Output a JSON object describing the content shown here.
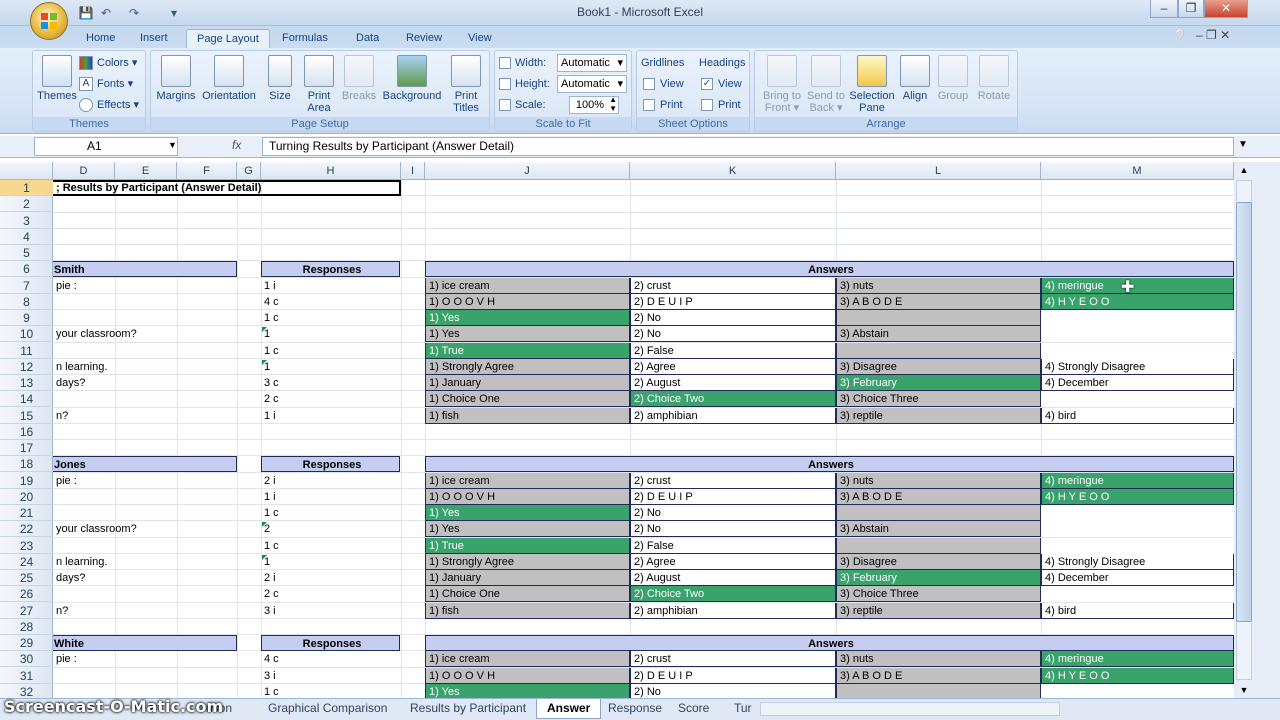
{
  "window": {
    "title": "Book1 - Microsoft Excel"
  },
  "colors": {
    "header_fill": "#c5cdf0",
    "gray_fill": "#c0c0c0",
    "green_fill": "#3aa36b"
  },
  "tabs": [
    "Home",
    "Insert",
    "Page Layout",
    "Formulas",
    "Data",
    "Review",
    "View"
  ],
  "active_tab": "Page Layout",
  "ribbon": {
    "themes": {
      "themes": "Themes",
      "colors": "Colors",
      "fonts": "Fonts",
      "effects": "Effects",
      "label": "Themes"
    },
    "page_setup": {
      "margins": "Margins",
      "orientation": "Orientation",
      "size": "Size",
      "print_area_1": "Print",
      "print_area_2": "Area",
      "breaks": "Breaks",
      "background": "Background",
      "print_titles_1": "Print",
      "print_titles_2": "Titles",
      "label": "Page Setup"
    },
    "scale": {
      "width_label": "Width:",
      "width_value": "Automatic",
      "height_label": "Height:",
      "height_value": "Automatic",
      "scale_label": "Scale:",
      "scale_value": "100%",
      "label": "Scale to Fit"
    },
    "sheet_options": {
      "gridlines": "Gridlines",
      "headings": "Headings",
      "view": "View",
      "print": "Print",
      "label": "Sheet Options"
    },
    "arrange": {
      "bring_1": "Bring to",
      "bring_2": "Front",
      "send_1": "Send to",
      "send_2": "Back",
      "selection_1": "Selection",
      "selection_2": "Pane",
      "align": "Align",
      "group": "Group",
      "rotate": "Rotate",
      "label": "Arrange"
    }
  },
  "formula_bar": {
    "name_box": "A1",
    "fx": "fx",
    "content": "Turning Results by Participant (Answer Detail)"
  },
  "columns": [
    "D",
    "E",
    "F",
    "G",
    "H",
    "I",
    "J",
    "K",
    "L",
    "M"
  ],
  "rows": [
    "1",
    "2",
    "3",
    "4",
    "5",
    "6",
    "7",
    "8",
    "9",
    "10",
    "11",
    "12",
    "13",
    "14",
    "15",
    "16",
    "17",
    "18",
    "19",
    "20",
    "21",
    "22",
    "23",
    "24",
    "25",
    "26",
    "27",
    "28",
    "29",
    "30",
    "31",
    "32"
  ],
  "sheet": {
    "title_cell": "; Results by Participant (Answer Detail)",
    "responses_header": "Responses",
    "answers_header": "Answers",
    "blocks": [
      {
        "name": "Smith",
        "questions": [
          "pie :",
          "",
          "",
          "your classroom?",
          "",
          "n learning.",
          "days?",
          "",
          "n?"
        ],
        "responses": [
          "1 i",
          "4 c",
          "1 c",
          "1",
          "1 c",
          "1",
          "3 c",
          "2 c",
          "1 i"
        ],
        "answers": [
          [
            "1)  ice cream",
            "2)  crust",
            "3)  nuts",
            "4)  meringue"
          ],
          [
            "1)  O O O V H",
            "2)  D E U I P",
            "3)  A B O D E",
            "4)  H Y E O O"
          ],
          [
            "1)  Yes",
            "2)  No",
            "",
            ""
          ],
          [
            "1)  Yes",
            "2)  No",
            "3)  Abstain",
            ""
          ],
          [
            "1)  True",
            "2)  False",
            "",
            ""
          ],
          [
            "1)  Strongly Agree",
            "2)  Agree",
            "3)  Disagree",
            "4)  Strongly Disagree"
          ],
          [
            "1)  January",
            "2)  August",
            "3)  February",
            "4)  December"
          ],
          [
            "1)  Choice One",
            "2)  Choice Two",
            "3)  Choice Three",
            ""
          ],
          [
            "1)  fish",
            "2)  amphibian",
            "3)  reptile",
            "4)  bird"
          ]
        ]
      },
      {
        "name": "Jones",
        "questions": [
          "pie :",
          "",
          "",
          "your classroom?",
          "",
          "n learning.",
          "days?",
          "",
          "n?"
        ],
        "responses": [
          "2 i",
          "1 i",
          "1 c",
          "2",
          "1 c",
          "1",
          "2 i",
          "2 c",
          "3 i"
        ],
        "answers": [
          [
            "1)  ice cream",
            "2)  crust",
            "3)  nuts",
            "4)  meringue"
          ],
          [
            "1)  O O O V H",
            "2)  D E U I P",
            "3)  A B O D E",
            "4)  H Y E O O"
          ],
          [
            "1)  Yes",
            "2)  No",
            "",
            ""
          ],
          [
            "1)  Yes",
            "2)  No",
            "3)  Abstain",
            ""
          ],
          [
            "1)  True",
            "2)  False",
            "",
            ""
          ],
          [
            "1)  Strongly Agree",
            "2)  Agree",
            "3)  Disagree",
            "4)  Strongly Disagree"
          ],
          [
            "1)  January",
            "2)  August",
            "3)  February",
            "4)  December"
          ],
          [
            "1)  Choice One",
            "2)  Choice Two",
            "3)  Choice Three",
            ""
          ],
          [
            "1)  fish",
            "2)  amphibian",
            "3)  reptile",
            "4)  bird"
          ]
        ]
      },
      {
        "name": "White",
        "questions": [
          "pie :",
          "",
          ""
        ],
        "responses": [
          "4 c",
          "3 i",
          "1 c"
        ],
        "answers": [
          [
            "1)  ice cream",
            "2)  crust",
            "3)  nuts",
            "4)  meringue"
          ],
          [
            "1)  O O O V H",
            "2)  D E U I P",
            "3)  A B O D E",
            "4)  H Y E O O"
          ],
          [
            "1)  Yes",
            "2)  No",
            "",
            ""
          ]
        ]
      }
    ]
  },
  "sheet_tabs": [
    "rison",
    "Graphical Comparison",
    "Results by Participant",
    "Answer",
    "Response",
    "Score",
    "Tur"
  ],
  "active_sheet": "Answer",
  "watermark": "Screencast-O-Matic.com"
}
